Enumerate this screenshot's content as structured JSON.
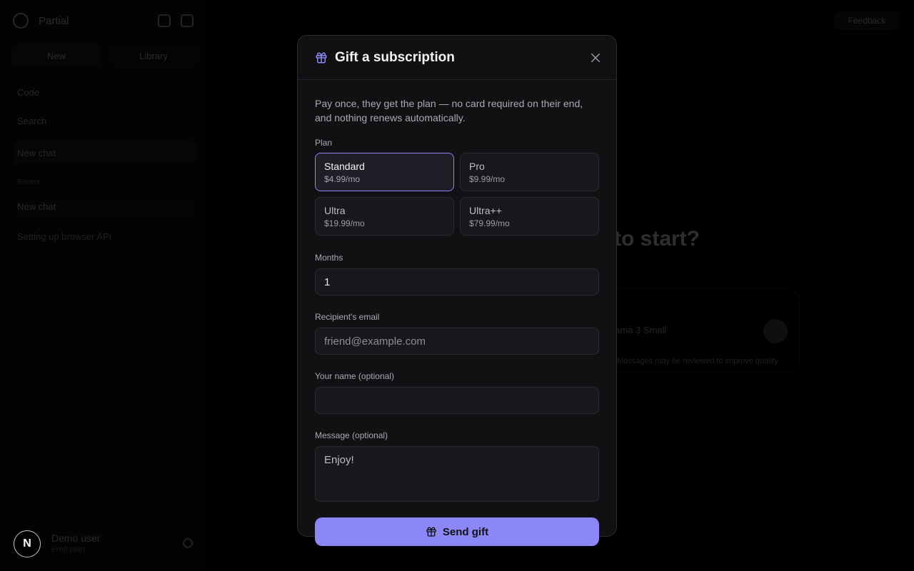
{
  "background": {
    "app_name": "Partial",
    "new_button": "New",
    "secondary_button": "Library",
    "nav": [
      "Code",
      "Search",
      "New chat"
    ],
    "section_label": "Recent",
    "chats": [
      "New chat",
      "Setting up browser API"
    ],
    "user_name": "Demo user",
    "user_sub": "Free plan",
    "top_right_button": "Feedback",
    "hero_text": "to start?",
    "composer_model": "Llama 3 Small",
    "composer_note": "Messages may be reviewed to improve quality"
  },
  "avatar_letter": "N",
  "modal": {
    "title": "Gift a subscription",
    "title_icon": "gift-icon",
    "close_icon": "close-icon",
    "description": "Pay once, they get the plan — no card required on their end, and nothing renews automatically.",
    "plan_label": "Plan",
    "plans": [
      {
        "name": "Standard",
        "price": "$4.99/mo",
        "selected": true
      },
      {
        "name": "Pro",
        "price": "$9.99/mo",
        "selected": false
      },
      {
        "name": "Ultra",
        "price": "$19.99/mo",
        "selected": false
      },
      {
        "name": "Ultra++",
        "price": "$79.99/mo",
        "selected": false
      }
    ],
    "months_label": "Months",
    "months_value": "1",
    "email_label": "Recipient's email",
    "email_placeholder": "friend@example.com",
    "email_value": "",
    "name_label": "Your name (optional)",
    "name_value": "",
    "message_label": "Message (optional)",
    "message_value": "Enjoy!",
    "send_label": "Send gift"
  },
  "colors": {
    "accent": "#8b87f6",
    "modal_bg": "#111114",
    "page_bg": "#000000"
  }
}
